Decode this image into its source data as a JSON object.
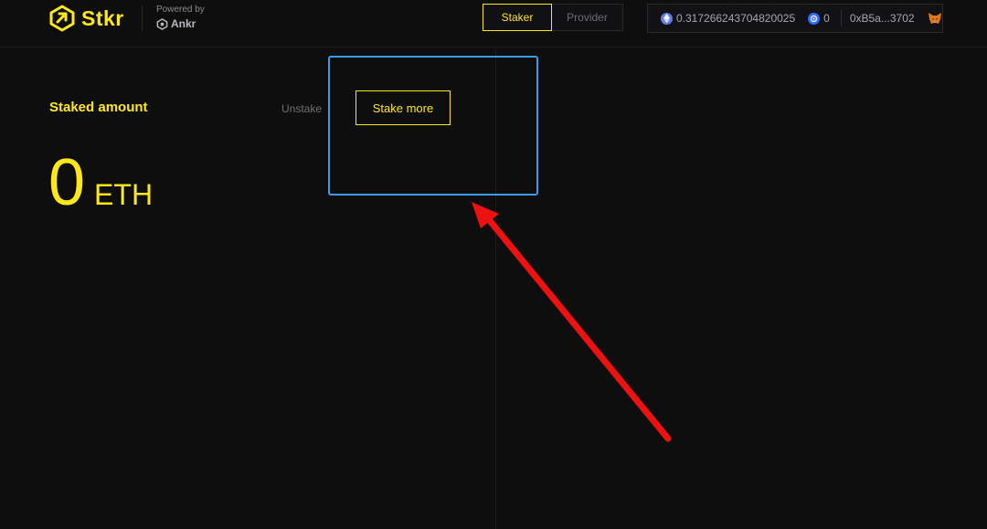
{
  "header": {
    "logo_text": "Stkr",
    "powered_by": "Powered by",
    "ankr_text": "Ankr",
    "tabs": [
      {
        "label": "Staker",
        "active": true
      },
      {
        "label": "Provider",
        "active": false
      }
    ],
    "wallet": {
      "eth_balance": "0.317266243704820025",
      "ankr_balance": "0",
      "address": "0xB5a...3702"
    }
  },
  "main": {
    "staked_label": "Staked amount",
    "staked_amount": "0",
    "staked_unit": "ETH",
    "unstake_label": "Unstake",
    "stake_more_label": "Stake more"
  },
  "colors": {
    "accent": "#ffe819",
    "background": "#0e0e0f",
    "highlight": "#3d9be9",
    "arrow": "#ee1111"
  },
  "icons": [
    "stkr-logo-icon",
    "ankr-logo-icon",
    "eth-icon",
    "bnb-icon",
    "metamask-fox-icon"
  ]
}
